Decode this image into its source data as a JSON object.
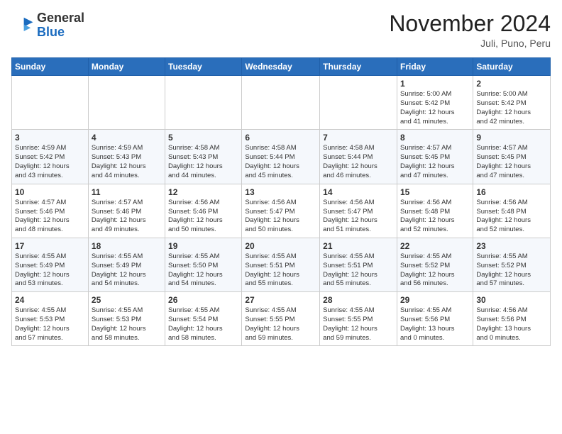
{
  "header": {
    "logo": {
      "line1": "General",
      "line2": "Blue"
    },
    "month": "November 2024",
    "location": "Juli, Puno, Peru"
  },
  "weekdays": [
    "Sunday",
    "Monday",
    "Tuesday",
    "Wednesday",
    "Thursday",
    "Friday",
    "Saturday"
  ],
  "weeks": [
    [
      {
        "day": "",
        "info": ""
      },
      {
        "day": "",
        "info": ""
      },
      {
        "day": "",
        "info": ""
      },
      {
        "day": "",
        "info": ""
      },
      {
        "day": "",
        "info": ""
      },
      {
        "day": "1",
        "info": "Sunrise: 5:00 AM\nSunset: 5:42 PM\nDaylight: 12 hours\nand 41 minutes."
      },
      {
        "day": "2",
        "info": "Sunrise: 5:00 AM\nSunset: 5:42 PM\nDaylight: 12 hours\nand 42 minutes."
      }
    ],
    [
      {
        "day": "3",
        "info": "Sunrise: 4:59 AM\nSunset: 5:42 PM\nDaylight: 12 hours\nand 43 minutes."
      },
      {
        "day": "4",
        "info": "Sunrise: 4:59 AM\nSunset: 5:43 PM\nDaylight: 12 hours\nand 44 minutes."
      },
      {
        "day": "5",
        "info": "Sunrise: 4:58 AM\nSunset: 5:43 PM\nDaylight: 12 hours\nand 44 minutes."
      },
      {
        "day": "6",
        "info": "Sunrise: 4:58 AM\nSunset: 5:44 PM\nDaylight: 12 hours\nand 45 minutes."
      },
      {
        "day": "7",
        "info": "Sunrise: 4:58 AM\nSunset: 5:44 PM\nDaylight: 12 hours\nand 46 minutes."
      },
      {
        "day": "8",
        "info": "Sunrise: 4:57 AM\nSunset: 5:45 PM\nDaylight: 12 hours\nand 47 minutes."
      },
      {
        "day": "9",
        "info": "Sunrise: 4:57 AM\nSunset: 5:45 PM\nDaylight: 12 hours\nand 47 minutes."
      }
    ],
    [
      {
        "day": "10",
        "info": "Sunrise: 4:57 AM\nSunset: 5:46 PM\nDaylight: 12 hours\nand 48 minutes."
      },
      {
        "day": "11",
        "info": "Sunrise: 4:57 AM\nSunset: 5:46 PM\nDaylight: 12 hours\nand 49 minutes."
      },
      {
        "day": "12",
        "info": "Sunrise: 4:56 AM\nSunset: 5:46 PM\nDaylight: 12 hours\nand 50 minutes."
      },
      {
        "day": "13",
        "info": "Sunrise: 4:56 AM\nSunset: 5:47 PM\nDaylight: 12 hours\nand 50 minutes."
      },
      {
        "day": "14",
        "info": "Sunrise: 4:56 AM\nSunset: 5:47 PM\nDaylight: 12 hours\nand 51 minutes."
      },
      {
        "day": "15",
        "info": "Sunrise: 4:56 AM\nSunset: 5:48 PM\nDaylight: 12 hours\nand 52 minutes."
      },
      {
        "day": "16",
        "info": "Sunrise: 4:56 AM\nSunset: 5:48 PM\nDaylight: 12 hours\nand 52 minutes."
      }
    ],
    [
      {
        "day": "17",
        "info": "Sunrise: 4:55 AM\nSunset: 5:49 PM\nDaylight: 12 hours\nand 53 minutes."
      },
      {
        "day": "18",
        "info": "Sunrise: 4:55 AM\nSunset: 5:49 PM\nDaylight: 12 hours\nand 54 minutes."
      },
      {
        "day": "19",
        "info": "Sunrise: 4:55 AM\nSunset: 5:50 PM\nDaylight: 12 hours\nand 54 minutes."
      },
      {
        "day": "20",
        "info": "Sunrise: 4:55 AM\nSunset: 5:51 PM\nDaylight: 12 hours\nand 55 minutes."
      },
      {
        "day": "21",
        "info": "Sunrise: 4:55 AM\nSunset: 5:51 PM\nDaylight: 12 hours\nand 55 minutes."
      },
      {
        "day": "22",
        "info": "Sunrise: 4:55 AM\nSunset: 5:52 PM\nDaylight: 12 hours\nand 56 minutes."
      },
      {
        "day": "23",
        "info": "Sunrise: 4:55 AM\nSunset: 5:52 PM\nDaylight: 12 hours\nand 57 minutes."
      }
    ],
    [
      {
        "day": "24",
        "info": "Sunrise: 4:55 AM\nSunset: 5:53 PM\nDaylight: 12 hours\nand 57 minutes."
      },
      {
        "day": "25",
        "info": "Sunrise: 4:55 AM\nSunset: 5:53 PM\nDaylight: 12 hours\nand 58 minutes."
      },
      {
        "day": "26",
        "info": "Sunrise: 4:55 AM\nSunset: 5:54 PM\nDaylight: 12 hours\nand 58 minutes."
      },
      {
        "day": "27",
        "info": "Sunrise: 4:55 AM\nSunset: 5:55 PM\nDaylight: 12 hours\nand 59 minutes."
      },
      {
        "day": "28",
        "info": "Sunrise: 4:55 AM\nSunset: 5:55 PM\nDaylight: 12 hours\nand 59 minutes."
      },
      {
        "day": "29",
        "info": "Sunrise: 4:55 AM\nSunset: 5:56 PM\nDaylight: 13 hours\nand 0 minutes."
      },
      {
        "day": "30",
        "info": "Sunrise: 4:56 AM\nSunset: 5:56 PM\nDaylight: 13 hours\nand 0 minutes."
      }
    ]
  ]
}
